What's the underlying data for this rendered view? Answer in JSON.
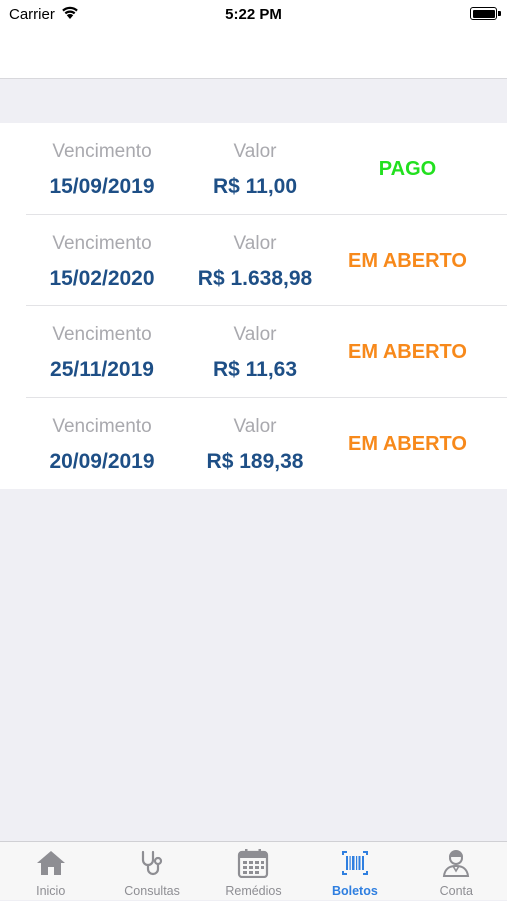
{
  "status_bar": {
    "carrier": "Carrier",
    "time": "5:22 PM"
  },
  "boletos": [
    {
      "vencimento_label": "Vencimento",
      "valor_label": "Valor",
      "vencimento": "15/09/2019",
      "valor": "R$ 11,00",
      "status": "PAGO",
      "status_color": "#22e01f"
    },
    {
      "vencimento_label": "Vencimento",
      "valor_label": "Valor",
      "vencimento": "15/02/2020",
      "valor": "R$ 1.638,98",
      "status": "EM ABERTO",
      "status_color": "#f7891b"
    },
    {
      "vencimento_label": "Vencimento",
      "valor_label": "Valor",
      "vencimento": "25/11/2019",
      "valor": "R$ 11,63",
      "status": "EM ABERTO",
      "status_color": "#f7891b"
    },
    {
      "vencimento_label": "Vencimento",
      "valor_label": "Valor",
      "vencimento": "20/09/2019",
      "valor": "R$ 189,38",
      "status": "EM ABERTO",
      "status_color": "#f7891b"
    }
  ],
  "tab_bar": {
    "active_color": "#2f7fe0",
    "inactive_color": "#8e8e93",
    "items": [
      {
        "label": "Inicio",
        "icon": "home-icon",
        "active": false
      },
      {
        "label": "Consultas",
        "icon": "stethoscope-icon",
        "active": false
      },
      {
        "label": "Remédios",
        "icon": "calendar-icon",
        "active": false
      },
      {
        "label": "Boletos",
        "icon": "barcode-icon",
        "active": true
      },
      {
        "label": "Conta",
        "icon": "user-icon",
        "active": false
      }
    ]
  }
}
